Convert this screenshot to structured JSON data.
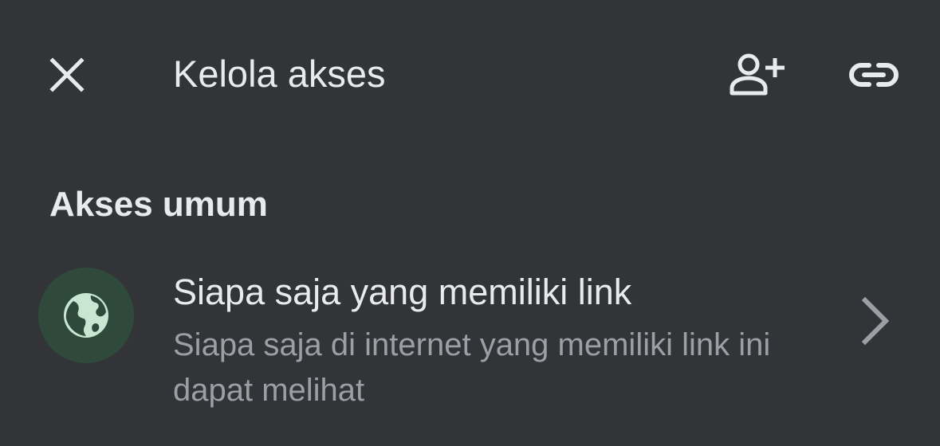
{
  "header": {
    "title": "Kelola akses",
    "close_icon": "close-icon",
    "add_person_icon": "person-add-icon",
    "link_icon": "link-icon"
  },
  "general_access": {
    "heading": "Akses umum",
    "option": {
      "icon": "globe-icon",
      "title": "Siapa saja yang memiliki link",
      "description": "Siapa saja di internet yang memiliki link ini dapat melihat"
    }
  },
  "colors": {
    "background": "#333438",
    "primary_text": "#e8eaed",
    "secondary_text": "#9aa0a6",
    "avatar_bg": "#2f4a3b",
    "avatar_icon": "#c8e6d2"
  }
}
